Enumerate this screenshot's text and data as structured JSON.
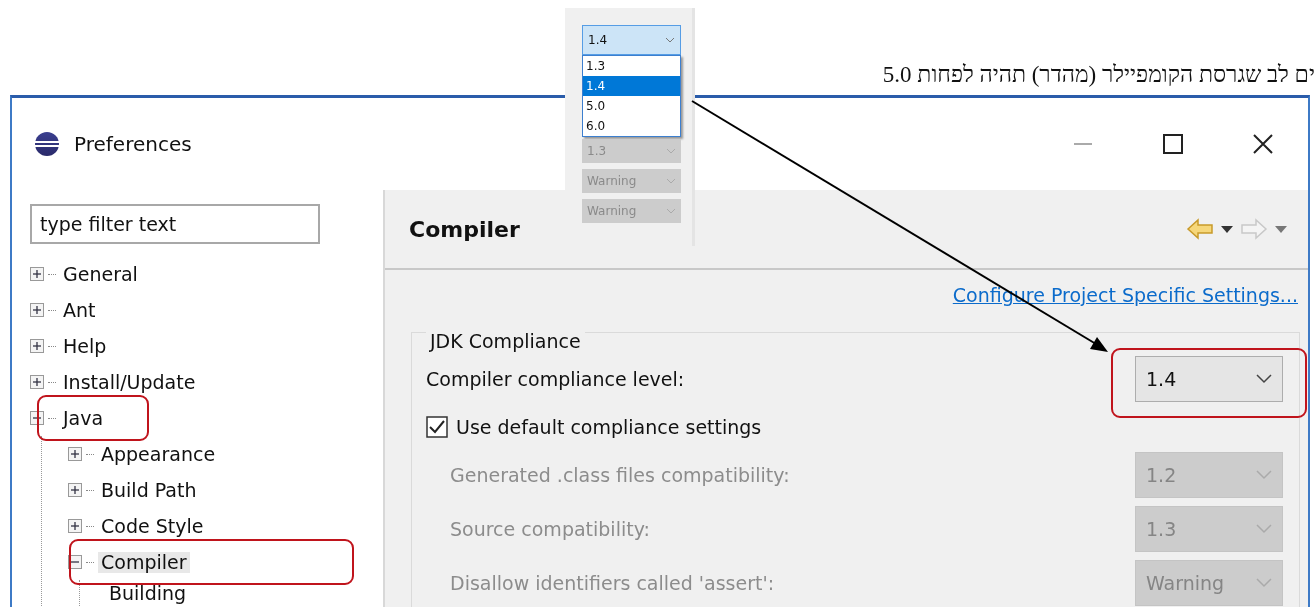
{
  "note": {
    "text": "ים לב שגרסת הקומפיילר (מהדר) תהיה לפחות 5.0"
  },
  "inset": {
    "value": "1.4",
    "options": [
      {
        "label": "1.3",
        "selected": false
      },
      {
        "label": "1.4",
        "selected": true
      },
      {
        "label": "5.0",
        "selected": false
      },
      {
        "label": "6.0",
        "selected": false
      }
    ],
    "combos": [
      {
        "value": "1.3"
      },
      {
        "value": "Warning"
      },
      {
        "value": "Warning"
      }
    ]
  },
  "window": {
    "title": "Preferences"
  },
  "filter": {
    "placeholder": "type filter text"
  },
  "tree": [
    {
      "label": "General",
      "expanded": false,
      "selected": false
    },
    {
      "label": "Ant",
      "expanded": false,
      "selected": false
    },
    {
      "label": "Help",
      "expanded": false,
      "selected": false
    },
    {
      "label": "Install/Update",
      "expanded": false,
      "selected": false
    },
    {
      "label": "Java",
      "expanded": true,
      "selected": false,
      "children": [
        {
          "label": "Appearance",
          "expanded": false,
          "selected": false
        },
        {
          "label": "Build Path",
          "expanded": false,
          "selected": false
        },
        {
          "label": "Code Style",
          "expanded": false,
          "selected": false
        },
        {
          "label": "Compiler",
          "expanded": true,
          "selected": true,
          "children": [
            {
              "label": "Building",
              "selected": false
            }
          ]
        }
      ]
    }
  ],
  "page": {
    "title": "Compiler",
    "link": "Configure Project Specific Settings...",
    "group": {
      "title": "JDK Compliance",
      "rows": [
        {
          "kind": "combo",
          "label": "Compiler compliance level:",
          "value": "1.4",
          "disabled": false
        },
        {
          "kind": "checkbox",
          "label": "Use default compliance settings",
          "checked": true
        },
        {
          "kind": "combo",
          "label": "Generated .class files compatibility:",
          "value": "1.2",
          "disabled": true
        },
        {
          "kind": "combo",
          "label": "Source compatibility:",
          "value": "1.3",
          "disabled": true
        },
        {
          "kind": "combo",
          "label": "Disallow identifiers called 'assert':",
          "value": "Warning",
          "disabled": true
        }
      ]
    }
  }
}
